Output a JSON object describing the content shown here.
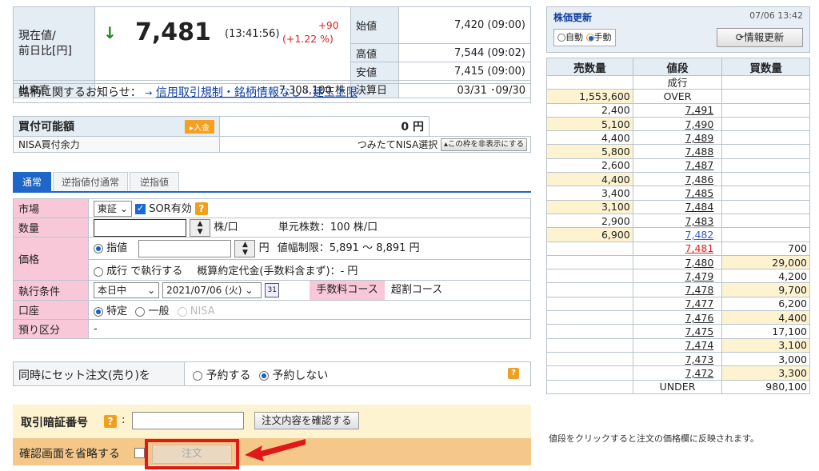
{
  "quote": {
    "current_label": "現在値/",
    "prev_label": "前日比[円]",
    "arrow": "↓",
    "price": "7,481",
    "time": "(13:41:56)",
    "change": "+90",
    "change_pct": "(+1.22 %)",
    "open_label": "始値",
    "open_value": "7,420 (09:00)",
    "high_label": "高値",
    "high_value": "7,544 (09:02)",
    "low_label": "安値",
    "low_value": "7,415 (09:00)",
    "volume_label": "出来高",
    "volume_value": "7,308,100 株",
    "settle_label": "決算日",
    "settle_value": "03/31 ･09/30"
  },
  "notice": {
    "label": "銘柄に関するお知らせ：",
    "arrow": "→",
    "link": "信用取引規制・銘柄情報なし・建玉上限"
  },
  "buying_power": {
    "label": "買付可能額",
    "deposit_btn": "▸入金",
    "amount": "0 円",
    "nisa_label": "NISA買付余力",
    "nisa_select": "つみたてNISA選択",
    "hide_btn": "▴この枠を非表示にする"
  },
  "tabs": [
    "通常",
    "逆指値付通常",
    "逆指値"
  ],
  "form": {
    "market_label": "市場",
    "market_value": "東証",
    "sor_label": "SOR有効",
    "qty_label": "数量",
    "qty_unit": "株/口",
    "unit_label": "単元株数：100 株/口",
    "price_label": "価格",
    "limit_label": "指値",
    "yen": "円",
    "range_label": "値幅制限：5,891 〜 8,891 円",
    "market_order": "成行 で執行する",
    "estimate": "概算約定代金(手数料含まず)：- 円",
    "cond_label": "執行条件",
    "cond_value": "本日中",
    "date_value": "2021/07/06 (火)",
    "fee_label": "手数料コース",
    "fee_value": "超割コース",
    "account_label": "口座",
    "acc_specific": "特定",
    "acc_general": "一般",
    "acc_nisa": "NISA",
    "deposit_label": "預り区分",
    "deposit_value": "-"
  },
  "set_order": {
    "label": "同時にセット注文(売り)を",
    "reserve": "予約する",
    "no_reserve": "予約しない"
  },
  "pin": {
    "label": "取引暗証番号",
    "colon": ":",
    "confirm_btn": "注文内容を確認する",
    "skip_label": "確認画面を省略する",
    "order_btn": "注文"
  },
  "board_head": {
    "title": "株価更新",
    "timestamp": "07/06 13:42",
    "auto": "自動",
    "manual": "手動",
    "refresh_btn": "情報更新"
  },
  "board": {
    "headers": [
      "売数量",
      "値段",
      "買数量"
    ],
    "rows": [
      {
        "sell": "",
        "price": "成行",
        "buy": ""
      },
      {
        "sell": "1,553,600",
        "price": "OVER",
        "buy": ""
      },
      {
        "sell": "2,400",
        "price": "7,491",
        "buy": ""
      },
      {
        "sell": "5,100",
        "price": "7,490",
        "buy": ""
      },
      {
        "sell": "4,400",
        "price": "7,489",
        "buy": ""
      },
      {
        "sell": "5,800",
        "price": "7,488",
        "buy": ""
      },
      {
        "sell": "2,600",
        "price": "7,487",
        "buy": ""
      },
      {
        "sell": "4,400",
        "price": "7,486",
        "buy": ""
      },
      {
        "sell": "3,400",
        "price": "7,485",
        "buy": ""
      },
      {
        "sell": "3,100",
        "price": "7,484",
        "buy": ""
      },
      {
        "sell": "2,900",
        "price": "7,483",
        "buy": ""
      },
      {
        "sell": "6,900",
        "price": "7,482",
        "buy": ""
      },
      {
        "sell": "",
        "price": "7,481",
        "buy": "700"
      },
      {
        "sell": "",
        "price": "7,480",
        "buy": "29,000"
      },
      {
        "sell": "",
        "price": "7,479",
        "buy": "4,200"
      },
      {
        "sell": "",
        "price": "7,478",
        "buy": "9,700"
      },
      {
        "sell": "",
        "price": "7,477",
        "buy": "6,200"
      },
      {
        "sell": "",
        "price": "7,476",
        "buy": "4,400"
      },
      {
        "sell": "",
        "price": "7,475",
        "buy": "17,100"
      },
      {
        "sell": "",
        "price": "7,474",
        "buy": "3,100"
      },
      {
        "sell": "",
        "price": "7,473",
        "buy": "3,000"
      },
      {
        "sell": "",
        "price": "7,472",
        "buy": "3,300"
      },
      {
        "sell": "",
        "price": "UNDER",
        "buy": "980,100"
      }
    ],
    "footnote": "値段をクリックすると注文の価格欄に反映されます。"
  },
  "colors": {
    "down": "#1a8a1a",
    "up": "#e02020",
    "highlight": "#e02020"
  }
}
